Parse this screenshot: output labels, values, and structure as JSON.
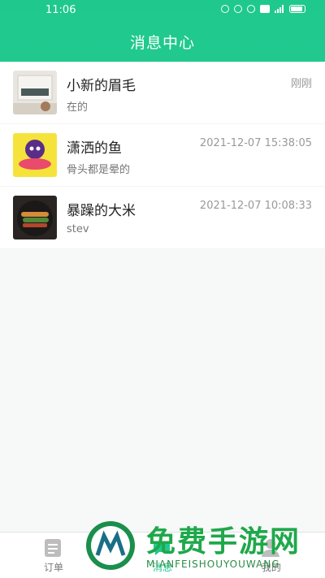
{
  "status": {
    "time": "11:06"
  },
  "header": {
    "title": "消息中心"
  },
  "messages": [
    {
      "name": "小新的眉毛",
      "preview": "在的",
      "time": "刚刚"
    },
    {
      "name": "潇洒的鱼",
      "preview": "骨头都是晕的",
      "time": "2021-12-07 15:38:05"
    },
    {
      "name": "暴躁的大米",
      "preview": "stev",
      "time": "2021-12-07 10:08:33"
    }
  ],
  "tabs": [
    {
      "label": "订单",
      "icon": "order-icon"
    },
    {
      "label": "消息",
      "icon": "message-icon"
    },
    {
      "label": "我的",
      "icon": "profile-icon"
    }
  ],
  "watermark": {
    "text": "免费手游网",
    "sub": "MIANFEISHOUYOUWANG"
  },
  "colors": {
    "accent": "#21c98f"
  }
}
